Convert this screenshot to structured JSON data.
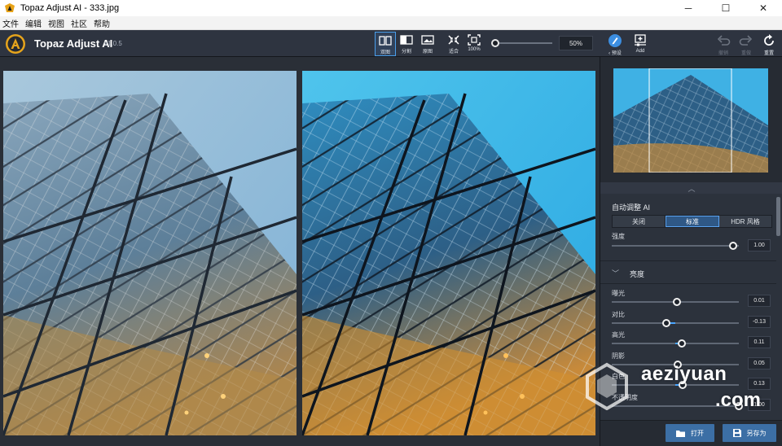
{
  "window": {
    "title": "Topaz Adjust AI - 333.jpg",
    "minimize": "─",
    "maximize": "☐",
    "close": "✕"
  },
  "menu": [
    "文件",
    "编辑",
    "视图",
    "社区",
    "帮助"
  ],
  "app": {
    "name": "Topaz Adjust AI",
    "version": "v1.0.5",
    "logo_letter": "A"
  },
  "view_tools": [
    {
      "label": "双图",
      "icon": "dual-view-icon",
      "active": true
    },
    {
      "label": "分割",
      "icon": "split-view-icon",
      "active": false
    },
    {
      "label": "原图",
      "icon": "original-view-icon",
      "active": false
    },
    {
      "label": "适合",
      "icon": "fit-icon",
      "active": false
    },
    {
      "label": "100%",
      "icon": "actual-size-icon",
      "active": false
    }
  ],
  "zoom": {
    "value_text": "50%",
    "level": 0.05
  },
  "right_tools": {
    "presets": "预设",
    "add": "Add",
    "undo": "撤销",
    "redo": "重做",
    "reset": "重置"
  },
  "auto_adjust": {
    "title": "自动调整 AI",
    "modes": [
      "关闭",
      "标准",
      "HDR 风格"
    ],
    "selected_mode": "标准",
    "strength_label": "强度",
    "strength_value": "1.00",
    "strength_level": 1.0
  },
  "brightness": {
    "title": "亮度",
    "sliders": [
      {
        "label": "曝光",
        "value": "0.01",
        "level": 0.51
      },
      {
        "label": "对比",
        "value": "-0.13",
        "level": 0.43
      },
      {
        "label": "高光",
        "value": "0.11",
        "level": 0.55
      },
      {
        "label": "阴影",
        "value": "0.05",
        "level": 0.52
      },
      {
        "label": "白色",
        "value": "0.13",
        "level": 0.56
      },
      {
        "label": "不透明度",
        "value": "1.00",
        "level": 1.0
      }
    ]
  },
  "buttons": {
    "open": "打开",
    "save_as": "另存为"
  },
  "watermark": {
    "line1": "aeziyuan",
    "line2": ".com"
  },
  "colors": {
    "accent": "#4a9eea",
    "toolbar": "#2e3440",
    "panel": "#2c323c",
    "button": "#3c6fa5"
  }
}
